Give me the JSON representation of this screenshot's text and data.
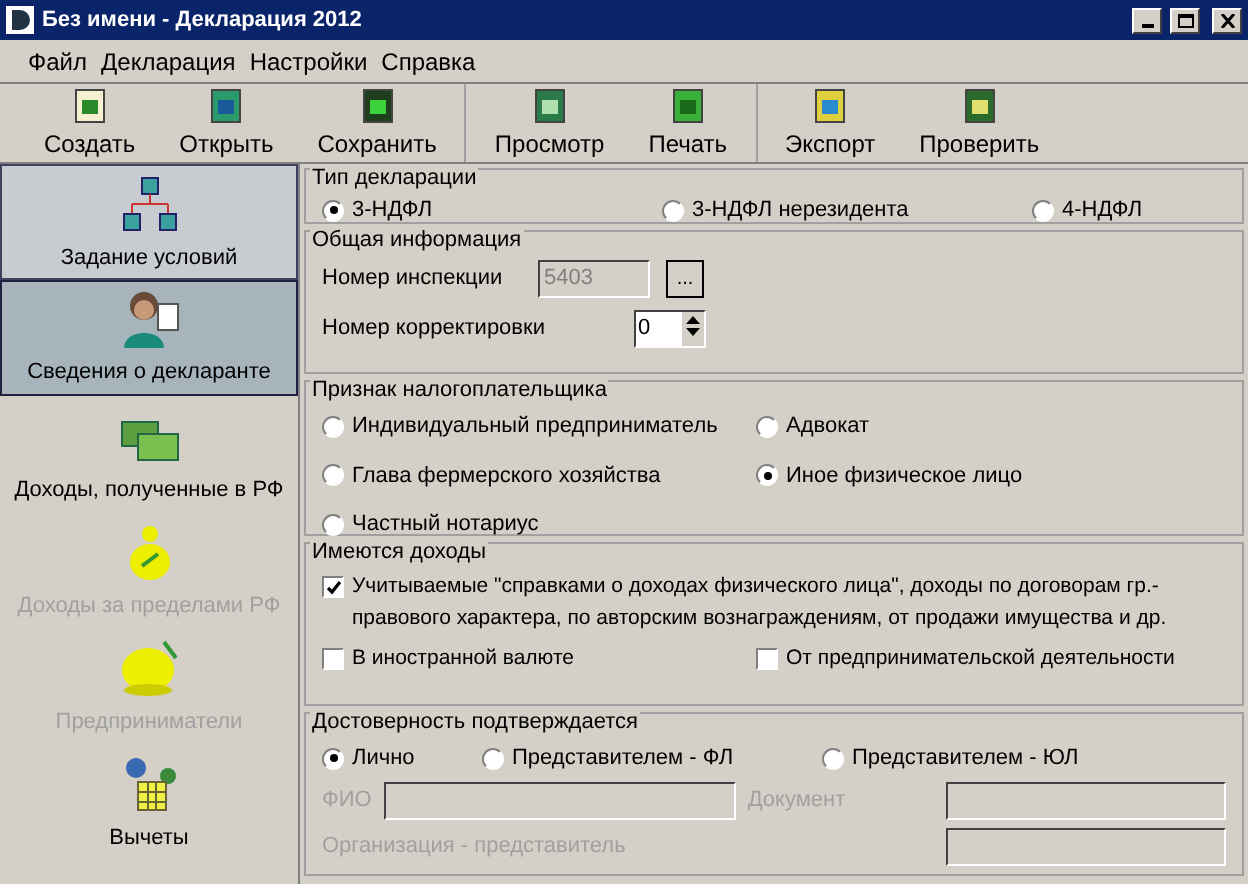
{
  "window": {
    "title": "Без имени - Декларация 2012"
  },
  "menu": [
    "Файл",
    "Декларация",
    "Настройки",
    "Справка"
  ],
  "toolbar": [
    [
      {
        "label": "Создать",
        "kind": "new"
      },
      {
        "label": "Открыть",
        "kind": "open"
      },
      {
        "label": "Сохранить",
        "kind": "save"
      }
    ],
    [
      {
        "label": "Просмотр",
        "kind": "preview"
      },
      {
        "label": "Печать",
        "kind": "print"
      }
    ],
    [
      {
        "label": "Экспорт",
        "kind": "export"
      },
      {
        "label": "Проверить",
        "kind": "check"
      }
    ]
  ],
  "sidebar": {
    "items": [
      {
        "label": "Задание условий",
        "kind": "conditions",
        "selected": false,
        "hovered": true,
        "disabled": false
      },
      {
        "label": "Сведения о декларанте",
        "kind": "person",
        "selected": true,
        "hovered": false,
        "disabled": false
      },
      {
        "label": "Доходы, полученные в РФ",
        "kind": "money",
        "selected": false,
        "hovered": false,
        "disabled": false
      },
      {
        "label": "Доходы за пределами РФ",
        "kind": "bag",
        "selected": false,
        "hovered": false,
        "disabled": true
      },
      {
        "label": "Предприниматели",
        "kind": "bag2",
        "selected": false,
        "hovered": false,
        "disabled": true
      },
      {
        "label": "Вычеты",
        "kind": "calc",
        "selected": false,
        "hovered": false,
        "disabled": false
      }
    ]
  },
  "declaration_type": {
    "title": "Тип декларации",
    "options": [
      {
        "label": "3-НДФЛ",
        "selected": true
      },
      {
        "label": "3-НДФЛ нерезидента",
        "selected": false
      },
      {
        "label": "4-НДФЛ",
        "selected": false
      }
    ]
  },
  "general_info": {
    "title": "Общая информация",
    "inspection": {
      "label": "Номер инспекции",
      "value": "5403",
      "disabled": true,
      "button": "..."
    },
    "correction": {
      "label": "Номер корректировки",
      "value": "0"
    }
  },
  "taxpayer": {
    "title": "Признак налогоплательщика",
    "options": [
      {
        "label": "Индивидуальный предприниматель",
        "selected": false
      },
      {
        "label": "Адвокат",
        "selected": false
      },
      {
        "label": "Глава фермерского хозяйства",
        "selected": false
      },
      {
        "label": "Иное физическое лицо",
        "selected": true
      },
      {
        "label": "Частный нотариус",
        "selected": false
      }
    ]
  },
  "income": {
    "title": "Имеются доходы",
    "items": [
      {
        "label": "Учитываемые \"справками о доходах физического лица\", доходы по договорам гр.-правового характера, по авторским вознаграждениям, от продажи имущества и др.",
        "checked": true
      },
      {
        "label": "В иностранной валюте",
        "checked": false
      },
      {
        "label": "От предпринимательской деятельности",
        "checked": false
      }
    ]
  },
  "confirmation": {
    "title": "Достоверность подтверждается",
    "options": [
      {
        "label": "Лично",
        "selected": true
      },
      {
        "label": "Представителем - ФЛ",
        "selected": false
      },
      {
        "label": "Представителем - ЮЛ",
        "selected": false
      }
    ],
    "fields": [
      {
        "label": "ФИО",
        "disabled": true
      },
      {
        "label": "Документ",
        "disabled": true
      },
      {
        "label": "Организация - представитель",
        "disabled": true
      }
    ]
  }
}
